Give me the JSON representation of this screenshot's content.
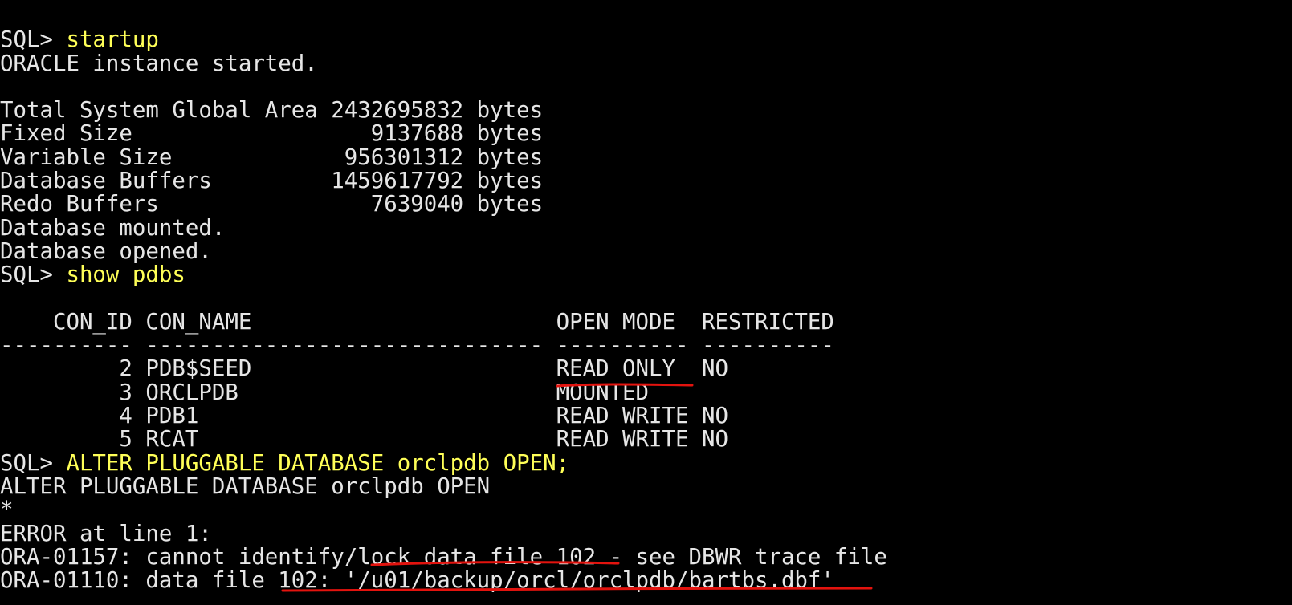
{
  "theme": {
    "background": "#000000",
    "text": "#e6e6e6",
    "command": "#ffff57",
    "annotation": "#e3130e"
  },
  "session": {
    "prompt": "SQL> ",
    "cmd_startup": "startup",
    "instance_started": "ORACLE instance started.",
    "sga_total": "Total System Global Area 2432695832 bytes",
    "sga_fixed": "Fixed Size                  9137688 bytes",
    "sga_variable": "Variable Size             956301312 bytes",
    "sga_buffers": "Database Buffers         1459617792 bytes",
    "sga_redo": "Redo Buffers                7639040 bytes",
    "db_mounted": "Database mounted.",
    "db_opened": "Database opened.",
    "cmd_show_pdbs": "show pdbs",
    "pdb_header": "    CON_ID CON_NAME                       OPEN MODE  RESTRICTED",
    "pdb_separator": "---------- ------------------------------ ---------- ----------",
    "pdb_rows": [
      "         2 PDB$SEED                       READ ONLY  NO",
      "         3 ORCLPDB                        MOUNTED",
      "         4 PDB1                           READ WRITE NO",
      "         5 RCAT                           READ WRITE NO"
    ],
    "cmd_alter": "ALTER PLUGGABLE DATABASE orclpdb OPEN;",
    "echo_alter": "ALTER PLUGGABLE DATABASE orclpdb OPEN",
    "error_marker": "*",
    "error_line": "ERROR at line 1:",
    "ora_01157": "ORA-01157: cannot identify/lock data file 102 - see DBWR trace file",
    "ora_01110": "ORA-01110: data file 102: '/u01/backup/orcl/orclpdb/bartbs.dbf'"
  }
}
